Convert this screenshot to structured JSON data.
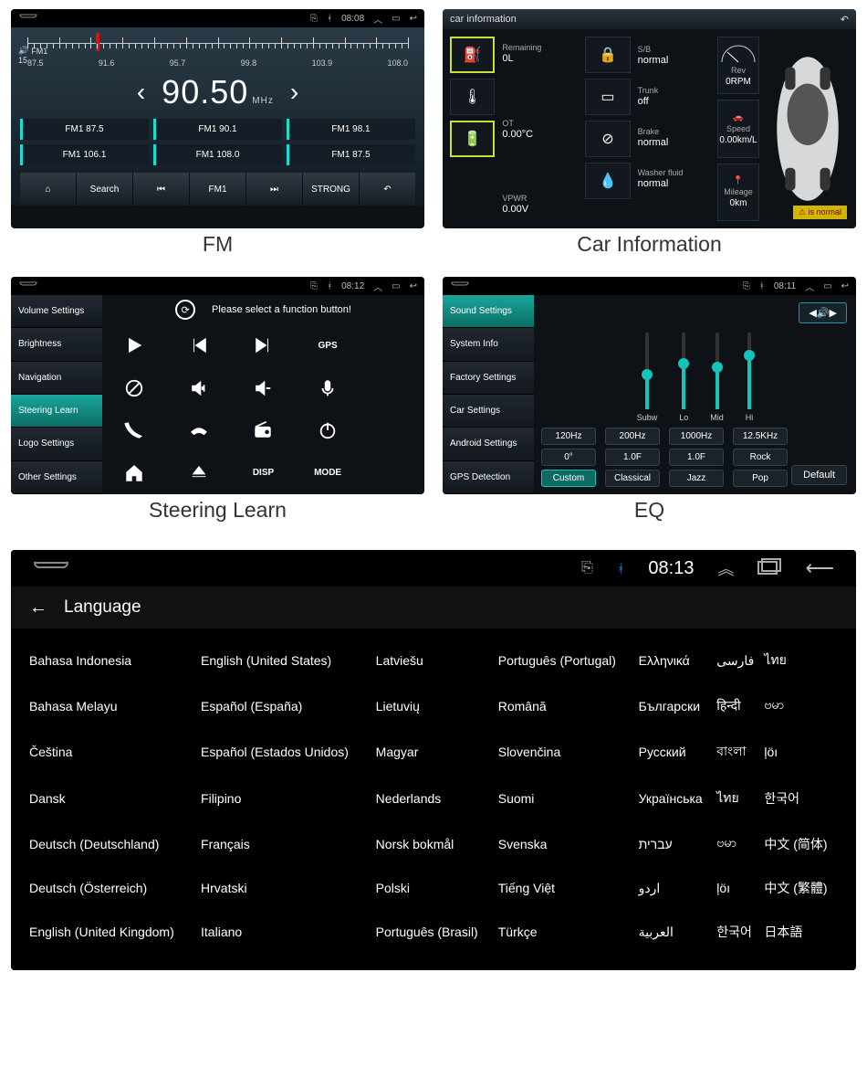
{
  "captions": {
    "fm": "FM",
    "ci": "Car Information",
    "sl": "Steering Learn",
    "eq": "EQ"
  },
  "status_small_fm": {
    "time": "08:08"
  },
  "status_small_sl": {
    "time": "08:12"
  },
  "status_small_eq": {
    "time": "08:11"
  },
  "status_big_lang": {
    "time": "08:13"
  },
  "fm": {
    "scale": [
      "87.5",
      "91.6",
      "95.7",
      "99.8",
      "103.9",
      "108.0"
    ],
    "vol_label": "FM1",
    "vol_val": "15",
    "freq": "90.50",
    "unit": "MHz",
    "presets": [
      "FM1 87.5",
      "FM1 90.1",
      "FM1 98.1",
      "FM1 106.1",
      "FM1 108.0",
      "FM1 87.5"
    ],
    "bottom": {
      "search": "Search",
      "band": "FM1",
      "scan": "STRONG"
    }
  },
  "ci": {
    "title": "car information",
    "rows": [
      {
        "k": "Remaining",
        "v": "0L"
      },
      {
        "k": "S/B",
        "v": "normal"
      },
      {
        "k": "Trunk",
        "v": "off"
      },
      {
        "k": "OT",
        "v": "0.00°C"
      },
      {
        "k": "Brake",
        "v": "normal"
      },
      {
        "k": "VPWR",
        "v": "0.00V"
      },
      {
        "k": "Washer fluid",
        "v": "normal"
      }
    ],
    "gauges": [
      {
        "k": "Rev",
        "v": "0RPM"
      },
      {
        "k": "Speed",
        "v": "0.00km/L"
      },
      {
        "k": "Mileage",
        "v": "0km"
      }
    ],
    "status": "is normal"
  },
  "sl": {
    "side": [
      "Volume Settings",
      "Brightness",
      "Navigation",
      "Steering Learn",
      "Logo Settings",
      "Other Settings"
    ],
    "active_idx": 3,
    "prompt": "Please select a function button!",
    "labels": {
      "gps": "GPS",
      "disp": "DISP",
      "mode": "MODE"
    }
  },
  "eq": {
    "side": [
      "Sound Settings",
      "System Info",
      "Factory Settings",
      "Car Settings",
      "Android Settings",
      "GPS Detection"
    ],
    "active_idx": 0,
    "bands": [
      {
        "name": "Subw",
        "pos": 45
      },
      {
        "name": "Lo",
        "pos": 60
      },
      {
        "name": "Mid",
        "pos": 55
      },
      {
        "name": "Hi",
        "pos": 70
      }
    ],
    "row_freq": [
      "120Hz",
      "200Hz",
      "1000Hz",
      "12.5KHz"
    ],
    "row_fact": [
      "0°",
      "1.0F",
      "1.0F",
      "Rock"
    ],
    "row_preset": [
      "Custom",
      "Classical",
      "Jazz",
      "Pop"
    ],
    "default_btn": "Default"
  },
  "lang": {
    "title": "Language",
    "cols": [
      [
        "Bahasa Indonesia",
        "Bahasa Melayu",
        "Čeština",
        "Dansk",
        "Deutsch (Deutschland)",
        "Deutsch (Österreich)",
        "English (United Kingdom)"
      ],
      [
        "English (United States)",
        "Español (España)",
        "Español (Estados Unidos)",
        "Filipino",
        "Français",
        "Hrvatski",
        "Italiano"
      ],
      [
        "Latviešu",
        "Lietuvių",
        "Magyar",
        "Nederlands",
        "Norsk bokmål",
        "Polski",
        "Português (Brasil)"
      ],
      [
        "Português (Portugal)",
        "Română",
        "Slovenčina",
        "Suomi",
        "Svenska",
        "Tiếng Việt",
        "Türkçe"
      ],
      [
        "Ελληνικά",
        "Български",
        "Русский",
        "Українська",
        "עברית",
        "اردو",
        "العربية"
      ],
      [
        "فارسی",
        "हिन्दी",
        "বাংলা",
        "ไทย",
        "ဗမာ",
        "ļöı",
        "한국어"
      ],
      [
        "ไทย",
        "ဗမာ",
        "ļöı",
        "한국어",
        "中文 (简体)",
        "中文 (繁體)",
        "日本語"
      ]
    ]
  }
}
